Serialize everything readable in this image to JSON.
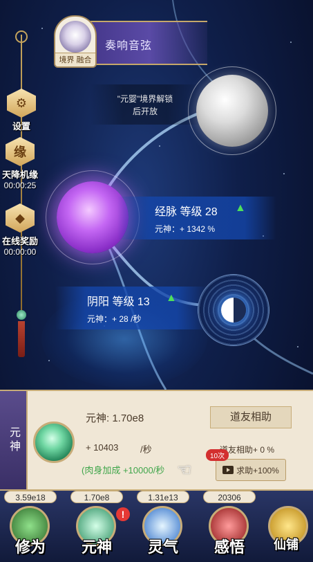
{
  "header": {
    "title": "奏响音弦",
    "avatar_label": "境界 融合"
  },
  "sidebar": {
    "settings_label": "设置",
    "fate_label": "天降机缘",
    "fate_timer": "00:00:25",
    "fate_glyph": "缘",
    "online_label": "在线奖励",
    "online_timer": "00:00:00"
  },
  "map": {
    "unlock_notice_line1": "\"元婴\"境界解锁",
    "unlock_notice_line2": "后开放",
    "meridian": {
      "title": "经脉 等级 28",
      "stat_prefix": "元神：+",
      "stat_value": "1342",
      "stat_unit": "%"
    },
    "yinyang": {
      "title": "阴阳 等级 13",
      "stat_prefix": "元神：+",
      "stat_value": "28",
      "stat_unit": "/秒"
    }
  },
  "panel": {
    "tab_label": "元神",
    "title": "元神: 1.70e8",
    "rate_value": "+ 10403",
    "rate_unit": "/秒",
    "body_bonus": "(肉身加成 +10000/秒",
    "friend_title": "道友相助",
    "friend_assist": "道友相助+ 0 %",
    "video_button": "求助+100%",
    "times_badge": "10次"
  },
  "nav": [
    {
      "value": "3.59e18",
      "label": "修为"
    },
    {
      "value": "1.70e8",
      "label": "元神"
    },
    {
      "value": "1.31e13",
      "label": "灵气"
    },
    {
      "value": "20306",
      "label": "感悟"
    },
    {
      "value": "",
      "label": "仙铺"
    }
  ],
  "nav_notice": "!"
}
